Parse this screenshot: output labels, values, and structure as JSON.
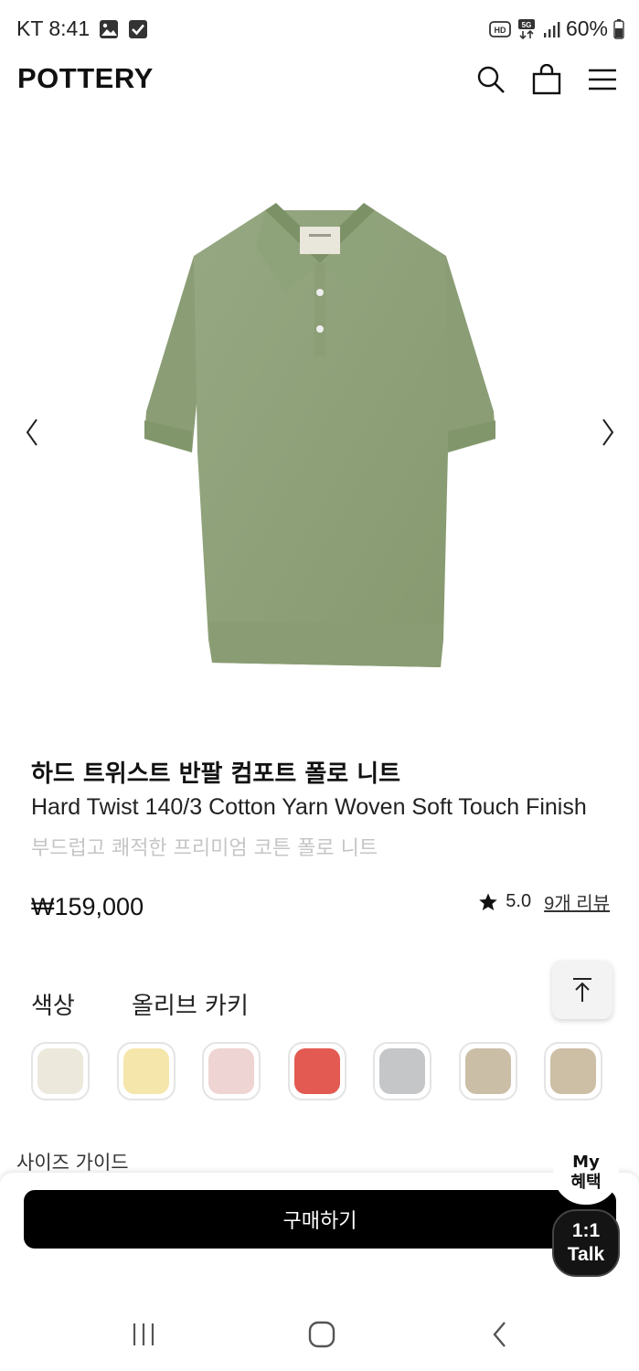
{
  "status_bar": {
    "carrier_time": "KT 8:41",
    "battery": "60%",
    "network": "5G"
  },
  "header": {
    "brand": "POTTERY"
  },
  "product": {
    "title_ko": "하드 트위스트 반팔 컴포트 폴로 니트",
    "title_en": "Hard Twist 140/3 Cotton Yarn Woven Soft Touch Finish",
    "subtitle": "부드럽고 쾌적한 프리미엄 코튼 폴로 니트",
    "price": "₩159,000",
    "rating": "5.0",
    "review_link": "9개 리뷰",
    "image_color": "#8fa27a"
  },
  "color_option": {
    "label": "색상",
    "value": "올리브 카키",
    "swatches": [
      {
        "color": "#ece8dc"
      },
      {
        "color": "#f5e6ab"
      },
      {
        "color": "#efd4d4"
      },
      {
        "color": "#e25a52"
      },
      {
        "color": "#c5c6c8"
      },
      {
        "color": "#cbbea6"
      },
      {
        "color": "#cdbfa5"
      }
    ]
  },
  "size_guide": "사이즈 가이드",
  "buy_button": "구매하기",
  "my_benefit": {
    "line1": "My",
    "line2": "혜택"
  },
  "talk_button": {
    "line1": "1:1",
    "line2": "Talk"
  }
}
